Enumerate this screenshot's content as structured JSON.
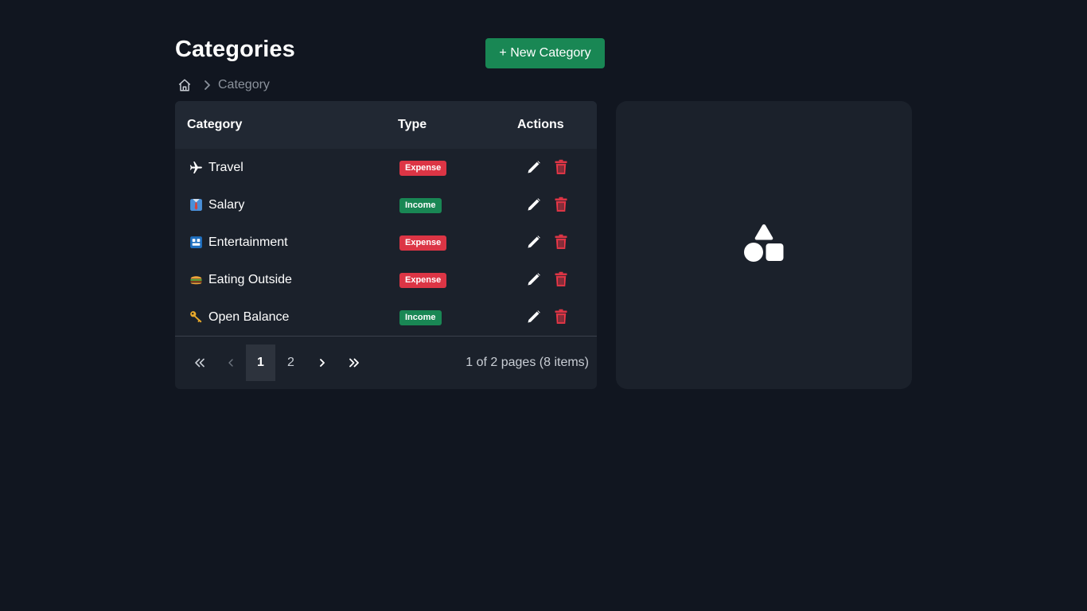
{
  "header": {
    "title": "Categories",
    "new_button_label": "+ New Category"
  },
  "breadcrumb": {
    "home_icon": "home-icon",
    "separator_icon": "chevron-right-icon",
    "current": "Category"
  },
  "table": {
    "columns": [
      "Category",
      "Type",
      "Actions"
    ],
    "rows": [
      {
        "emoji": "airplane",
        "name": "Travel",
        "type": "Expense"
      },
      {
        "emoji": "necktie-shirt",
        "name": "Salary",
        "type": "Income"
      },
      {
        "emoji": "game-panel",
        "name": "Entertainment",
        "type": "Expense"
      },
      {
        "emoji": "burger",
        "name": "Eating Outside",
        "type": "Expense"
      },
      {
        "emoji": "key",
        "name": "Open Balance",
        "type": "Income"
      }
    ],
    "action_icons": [
      "pencil-icon",
      "trash-icon"
    ]
  },
  "pagination": {
    "pages": [
      "1",
      "2"
    ],
    "current_page": "1",
    "info": "1 of 2 pages (8 items)"
  },
  "colors": {
    "background": "#111620",
    "card": "#1b212b",
    "header_row": "#212833",
    "accent_green": "#198754",
    "danger_red": "#dc3545"
  },
  "side_panel": {
    "icon": "shapes-icon"
  }
}
